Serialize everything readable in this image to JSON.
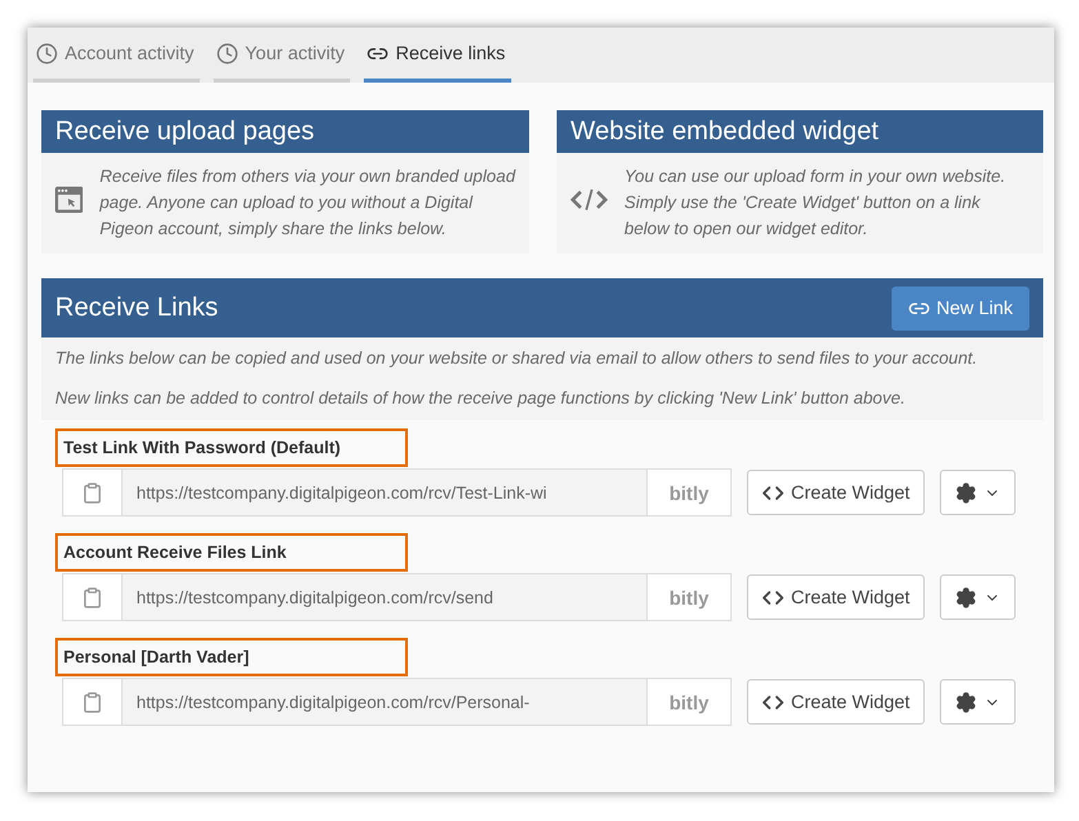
{
  "tabs": [
    {
      "label": "Account activity",
      "selected": false
    },
    {
      "label": "Your activity",
      "selected": false
    },
    {
      "label": "Receive links",
      "selected": true
    }
  ],
  "cards": [
    {
      "title": "Receive upload pages",
      "text": "Receive files from others via your own branded upload page. Anyone can upload to you without a Digital Pigeon account, simply share the links below."
    },
    {
      "title": "Website embedded widget",
      "text": "You can use our upload form in your own website. Simply use the 'Create Widget' button on a link below to open our widget editor."
    }
  ],
  "receive_links": {
    "title": "Receive Links",
    "new_button": "New Link",
    "paragraphs": [
      "The links below can be copied and used on your website or shared via email to allow others to send files to your account.",
      "New links can be added to control details of how the receive page functions by clicking 'New Link' button above."
    ],
    "links": [
      {
        "name": "Test Link With Password (Default)",
        "highlighted": true,
        "url": "https://testcompany.digitalpigeon.com/rcv/Test-Link-wi",
        "shortener": "bitly",
        "widget_button": "Create Widget"
      },
      {
        "name": "Account Receive Files Link",
        "highlighted": true,
        "url": "https://testcompany.digitalpigeon.com/rcv/send",
        "shortener": "bitly",
        "widget_button": "Create Widget"
      },
      {
        "name": "Personal [Darth Vader]",
        "highlighted": true,
        "url": "https://testcompany.digitalpigeon.com/rcv/Personal-",
        "shortener": "bitly",
        "widget_button": "Create Widget"
      }
    ]
  }
}
